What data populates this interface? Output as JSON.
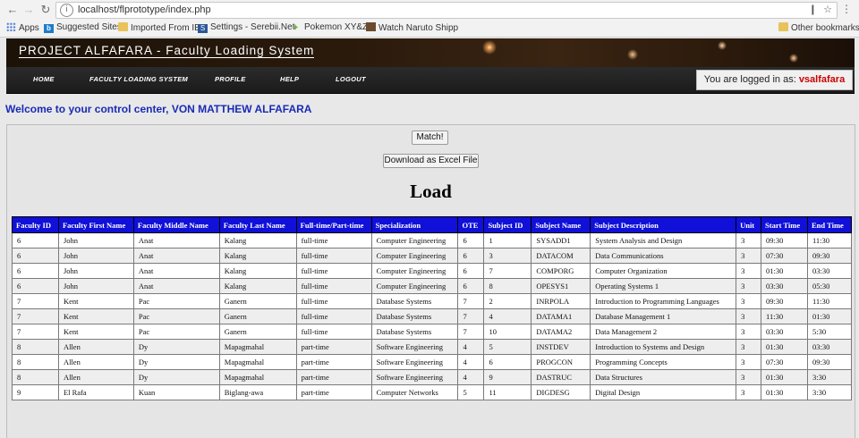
{
  "browser": {
    "url": "localhost/flprototype/index.php",
    "bookmarks": [
      {
        "label": "Apps",
        "icon": "apps-icon"
      },
      {
        "label": "Suggested Sites",
        "icon": "bing-icon"
      },
      {
        "label": "Imported From IE",
        "icon": "folder-icon"
      },
      {
        "label": "Settings - Serebii.Net",
        "icon": "serebii-icon"
      },
      {
        "label": "Pokemon XY&Z",
        "icon": "pokemon-icon"
      },
      {
        "label": "Watch Naruto Shipp",
        "icon": "naruto-icon"
      }
    ],
    "other_bookmarks": "Other bookmarks"
  },
  "header": {
    "title": "PROJECT ALFAFARA - Faculty Loading System",
    "nav": [
      "HOME",
      "FACULTY LOADING SYSTEM",
      "PROFILE",
      "HELP",
      "LOGOUT"
    ],
    "login_prefix": "You are logged in as: ",
    "username": "vsalfafara"
  },
  "welcome": "Welcome to your control center, VON MATTHEW ALFAFARA",
  "buttons": {
    "match": "Match!",
    "download": "Download as Excel File"
  },
  "load_title": "Load",
  "table": {
    "columns": [
      "Faculty ID",
      "Faculty First Name",
      "Faculty Middle Name",
      "Faculty Last Name",
      "Full-time/Part-time",
      "Specialization",
      "OTE",
      "Subject ID",
      "Subject Name",
      "Subject Description",
      "Unit",
      "Start Time",
      "End Time"
    ],
    "rows": [
      [
        "6",
        "John",
        "Anat",
        "Kalang",
        "full-time",
        "Computer Engineering",
        "6",
        "1",
        "SYSADD1",
        "System Analysis and Design",
        "3",
        "09:30",
        "11:30"
      ],
      [
        "6",
        "John",
        "Anat",
        "Kalang",
        "full-time",
        "Computer Engineering",
        "6",
        "3",
        "DATACOM",
        "Data Communications",
        "3",
        "07:30",
        "09:30"
      ],
      [
        "6",
        "John",
        "Anat",
        "Kalang",
        "full-time",
        "Computer Engineering",
        "6",
        "7",
        "COMPORG",
        "Computer Organization",
        "3",
        "01:30",
        "03:30"
      ],
      [
        "6",
        "John",
        "Anat",
        "Kalang",
        "full-time",
        "Computer Engineering",
        "6",
        "8",
        "OPESYS1",
        "Operating Systems 1",
        "3",
        "03:30",
        "05:30"
      ],
      [
        "7",
        "Kent",
        "Pac",
        "Ganern",
        "full-time",
        "Database Systems",
        "7",
        "2",
        "INRPOLA",
        "Introduction to Programming Languages",
        "3",
        "09:30",
        "11:30"
      ],
      [
        "7",
        "Kent",
        "Pac",
        "Ganern",
        "full-time",
        "Database Systems",
        "7",
        "4",
        "DATAMA1",
        "Database Management 1",
        "3",
        "11:30",
        "01:30"
      ],
      [
        "7",
        "Kent",
        "Pac",
        "Ganern",
        "full-time",
        "Database Systems",
        "7",
        "10",
        "DATAMA2",
        "Data Management 2",
        "3",
        "03:30",
        "5:30"
      ],
      [
        "8",
        "Allen",
        "Dy",
        "Mapagmahal",
        "part-time",
        "Software Engineering",
        "4",
        "5",
        "INSTDEV",
        "Introduction to Systems and Design",
        "3",
        "01:30",
        "03:30"
      ],
      [
        "8",
        "Allen",
        "Dy",
        "Mapagmahal",
        "part-time",
        "Software Engineering",
        "4",
        "6",
        "PROGCON",
        "Programming Concepts",
        "3",
        "07:30",
        "09:30"
      ],
      [
        "8",
        "Allen",
        "Dy",
        "Mapagmahal",
        "part-time",
        "Software Engineering",
        "4",
        "9",
        "DASTRUC",
        "Data Structures",
        "3",
        "01:30",
        "3:30"
      ],
      [
        "9",
        "El Rafa",
        "Kuan",
        "Biglang-awa",
        "part-time",
        "Computer Networks",
        "5",
        "11",
        "DIGDESG",
        "Digital Design",
        "3",
        "01:30",
        "3:30"
      ]
    ]
  },
  "colors": {
    "table_header": "#1010d8",
    "welcome_text": "#1a2bb5",
    "username": "#cc0000"
  }
}
